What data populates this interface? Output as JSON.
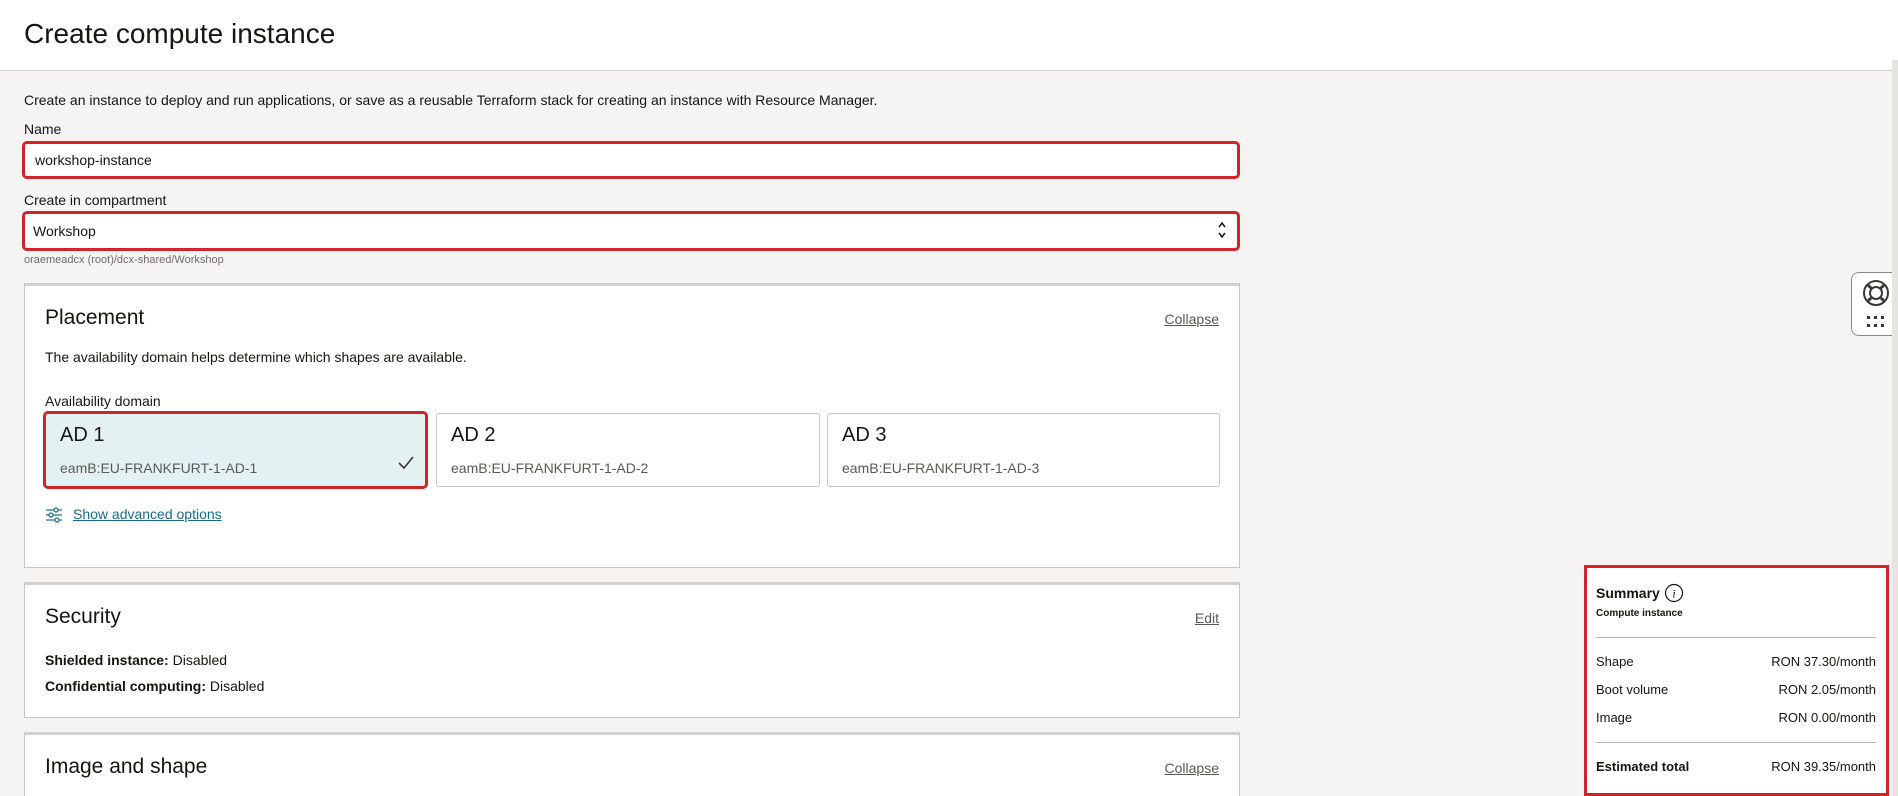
{
  "header": {
    "title": "Create compute instance"
  },
  "intro": "Create an instance to deploy and run applications, or save as a reusable Terraform stack for creating an instance with Resource Manager.",
  "name_field": {
    "label": "Name",
    "value": "workshop-instance"
  },
  "compartment": {
    "label": "Create in compartment",
    "value": "Workshop",
    "path": "oraemeadcx (root)/dcx-shared/Workshop"
  },
  "placement": {
    "title": "Placement",
    "action": "Collapse",
    "description": "The availability domain helps determine which shapes are available.",
    "ad_label": "Availability domain",
    "domains": [
      {
        "name": "AD 1",
        "id": "eamB:EU-FRANKFURT-1-AD-1",
        "selected": true
      },
      {
        "name": "AD 2",
        "id": "eamB:EU-FRANKFURT-1-AD-2",
        "selected": false
      },
      {
        "name": "AD 3",
        "id": "eamB:EU-FRANKFURT-1-AD-3",
        "selected": false
      }
    ],
    "advanced_link": "Show advanced options"
  },
  "security": {
    "title": "Security",
    "action": "Edit",
    "shielded_label": "Shielded instance:",
    "shielded_value": "Disabled",
    "confidential_label": "Confidential computing:",
    "confidential_value": "Disabled"
  },
  "image_shape": {
    "title": "Image and shape",
    "action": "Collapse"
  },
  "summary": {
    "title": "Summary",
    "subtitle": "Compute instance",
    "rows": [
      {
        "label": "Shape",
        "value": "RON 37.30/month"
      },
      {
        "label": "Boot volume",
        "value": "RON 2.05/month"
      },
      {
        "label": "Image",
        "value": "RON 0.00/month"
      }
    ],
    "total_label": "Estimated total",
    "total_value": "RON 39.35/month"
  },
  "colors": {
    "accent_link": "#1b6a8a",
    "highlight": "#d1232a",
    "selected_bg": "#e4f1f2"
  },
  "icons": [
    "check-icon",
    "sliders-icon",
    "info-icon",
    "lifebuoy-icon",
    "grid-dots-icon",
    "chevron-updown-icon"
  ]
}
